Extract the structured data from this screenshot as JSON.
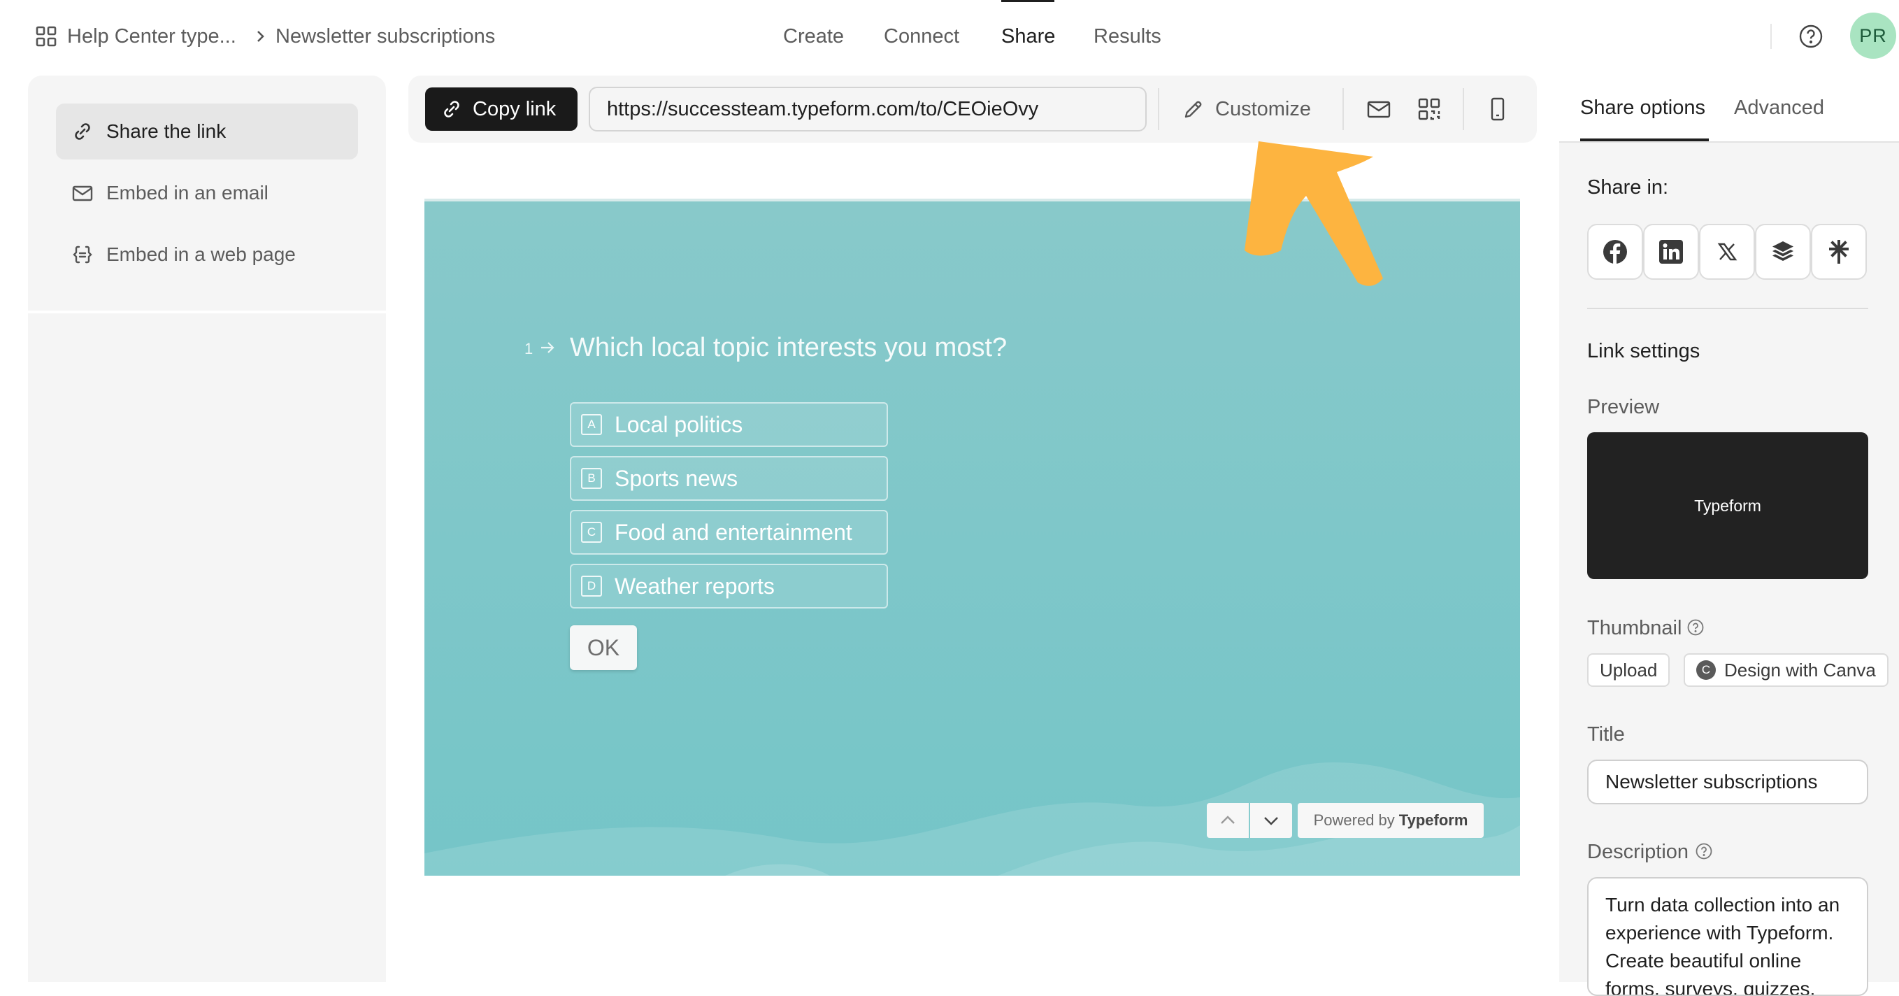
{
  "breadcrumb": {
    "workspace": "Help Center type...",
    "form": "Newsletter subscriptions"
  },
  "nav": {
    "create": "Create",
    "connect": "Connect",
    "share": "Share",
    "results": "Results",
    "active": "Share"
  },
  "user": {
    "initials": "PR"
  },
  "left_menu": [
    {
      "label": "Share the link",
      "icon": "link-icon",
      "active": true
    },
    {
      "label": "Embed in an email",
      "icon": "mail-icon",
      "active": false
    },
    {
      "label": "Embed in a web page",
      "icon": "code-braces-icon",
      "active": false
    }
  ],
  "toolbar": {
    "copy_label": "Copy link",
    "url": "https://successteam.typeform.com/to/CEOieOvy",
    "customize_label": "Customize",
    "icons": [
      "mail-icon",
      "qr-code-icon",
      "mobile-icon"
    ]
  },
  "form_preview": {
    "question_number": "1",
    "question": "Which local topic interests you most?",
    "choices": [
      {
        "key": "A",
        "label": "Local politics"
      },
      {
        "key": "B",
        "label": "Sports news"
      },
      {
        "key": "C",
        "label": "Food and entertainment"
      },
      {
        "key": "D",
        "label": "Weather reports"
      }
    ],
    "ok_label": "OK",
    "powered_prefix": "Powered by",
    "powered_brand": "Typeform",
    "background_color": "#7cc7c9"
  },
  "annotation": {
    "color": "#fdb440"
  },
  "right_panel": {
    "tabs": [
      {
        "label": "Share options",
        "active": true
      },
      {
        "label": "Advanced",
        "active": false
      }
    ],
    "share_in_label": "Share in:",
    "social": [
      "facebook-icon",
      "linkedin-icon",
      "x-icon",
      "buffer-icon",
      "linktree-icon"
    ],
    "link_settings_label": "Link settings",
    "preview_label": "Preview",
    "preview_card_text": "Typeform",
    "thumbnail_label": "Thumbnail",
    "upload_label": "Upload",
    "canva_label": "Design with Canva",
    "title_label": "Title",
    "title_value": "Newsletter subscriptions",
    "description_label": "Description",
    "description_value": "Turn data collection into an experience with Typeform. Create beautiful online forms, surveys, quizzes, and so much more. Try it for FREE."
  }
}
